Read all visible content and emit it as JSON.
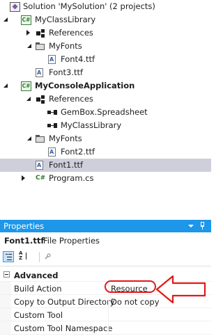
{
  "solution_explorer": {
    "solution_label": "Solution 'MySolution' (2 projects)",
    "project1": "MyClassLibrary",
    "references": "References",
    "myfonts": "MyFonts",
    "font4": "Font4.ttf",
    "font3": "Font3.ttf",
    "project2": "MyConsoleApplication",
    "references2": "References",
    "ref_gembox": "GemBox.Spreadsheet",
    "ref_myclasslib": "MyClassLibrary",
    "myfonts2": "MyFonts",
    "font2": "Font2.ttf",
    "font1": "Font1.ttf",
    "program": "Program.cs",
    "cs_badge": "C#",
    "font_badge": "A"
  },
  "properties": {
    "title": "Properties",
    "object_name": "Font1.ttf",
    "object_kind": "File Properties",
    "category": "Advanced",
    "rows": [
      {
        "name": "Build Action",
        "value": "Resource"
      },
      {
        "name": "Copy to Output Directory",
        "value": "Do not copy"
      },
      {
        "name": "Custom Tool",
        "value": ""
      },
      {
        "name": "Custom Tool Namespace",
        "value": ""
      }
    ],
    "sort_az_glyph": "A\nZ"
  },
  "colors": {
    "title_bar": "#1c97ea",
    "selection": "#cfcfdc",
    "annotation": "#e01818"
  }
}
